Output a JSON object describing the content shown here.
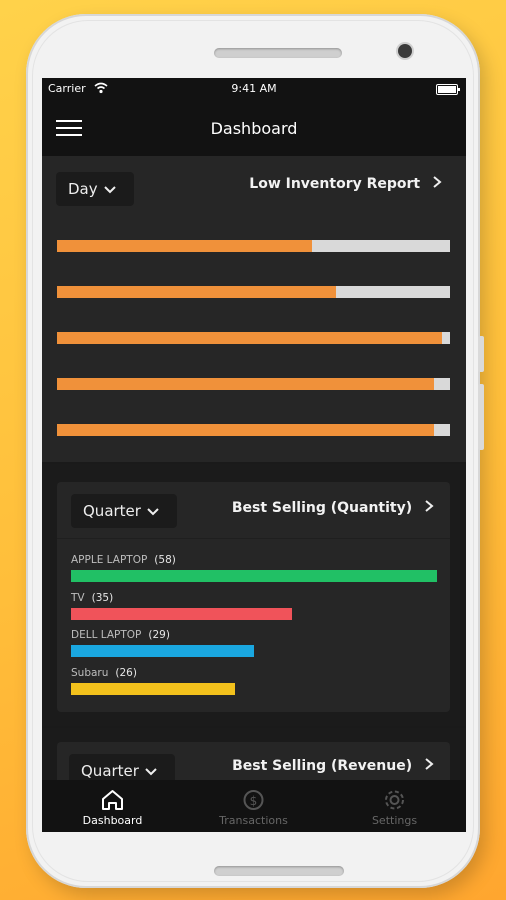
{
  "status_bar": {
    "carrier": "Carrier",
    "time": "9:41 AM"
  },
  "app_bar": {
    "title": "Dashboard"
  },
  "low_inventory": {
    "period": "Day",
    "title": "Low Inventory Report",
    "bars_fill_fraction": [
      0.65,
      0.71,
      0.98,
      0.96,
      0.96
    ]
  },
  "best_selling_quantity": {
    "period": "Quarter",
    "title": "Best Selling (Quantity)",
    "items": [
      {
        "label": "APPLE LAPTOP",
        "count": "(58)",
        "value": 58,
        "color": "#21c065"
      },
      {
        "label": "TV",
        "count": "(35)",
        "value": 35,
        "color": "#f0535a"
      },
      {
        "label": "DELL LAPTOP",
        "count": "(29)",
        "value": 29,
        "color": "#1aa7e0"
      },
      {
        "label": "Subaru",
        "count": "(26)",
        "value": 26,
        "color": "#f2c11c"
      }
    ]
  },
  "best_selling_revenue": {
    "period": "Quarter",
    "title": "Best Selling (Revenue)"
  },
  "bottom_nav": [
    {
      "label": "Dashboard",
      "icon": "home-icon",
      "active": true
    },
    {
      "label": "Transactions",
      "icon": "dollar-cycle-icon",
      "active": false
    },
    {
      "label": "Settings",
      "icon": "gear-icon",
      "active": false
    }
  ],
  "colors": {
    "accent_orange": "#f0913a",
    "track": "#d9d9d9",
    "background": "#1b1b1b"
  }
}
